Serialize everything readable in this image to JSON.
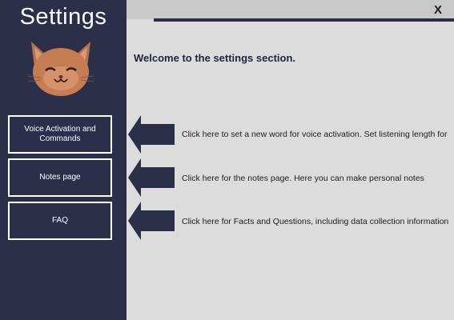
{
  "sidebar": {
    "title": "Settings",
    "avatar_icon": "cat-face-icon",
    "buttons": [
      {
        "label": "Voice Activation and Commands"
      },
      {
        "label": "Notes page"
      },
      {
        "label": "FAQ"
      }
    ]
  },
  "header": {
    "close_label": "X"
  },
  "main": {
    "welcome": "Welcome to the settings section.",
    "descriptions": [
      {
        "text": "Click here to set a new word for voice activation. Set listening length for"
      },
      {
        "text": "Click here for the notes page. Here you can make personal notes"
      },
      {
        "text": "Click here for Facts and Questions, including data collection information"
      }
    ]
  },
  "colors": {
    "sidebar": "#2b2f4a",
    "content_bg": "#dcdcdc",
    "accent_arrow": "#2b2f4a"
  }
}
